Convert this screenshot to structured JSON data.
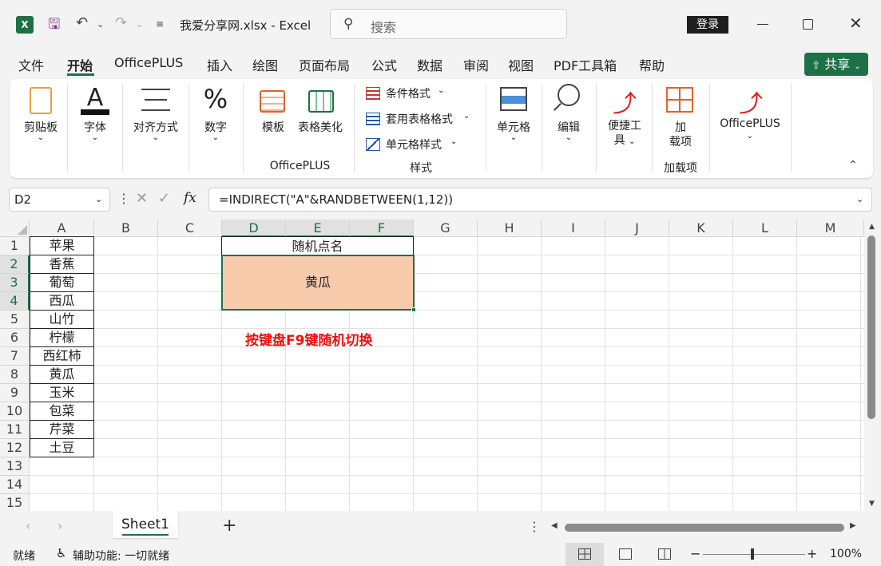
{
  "title_bar": {
    "file_title": "我爱分享网.xlsx  -  Excel",
    "search_placeholder": "搜索",
    "login_label": "登录"
  },
  "menu": {
    "items": [
      "文件",
      "开始",
      "OfficePLUS",
      "插入",
      "绘图",
      "页面布局",
      "公式",
      "数据",
      "审阅",
      "视图",
      "PDF工具箱",
      "帮助"
    ],
    "active": "开始",
    "share_label": "共享"
  },
  "ribbon": {
    "clipboard": "剪贴板",
    "font": "字体",
    "align": "对齐方式",
    "number": "数字",
    "template": "模板",
    "table_beautify": "表格美化",
    "officeplus_group": "OfficePLUS",
    "cond_format": "条件格式",
    "table_format": "套用表格格式",
    "cell_style": "单元格样式",
    "styles_group": "样式",
    "cells": "单元格",
    "edit": "编辑",
    "tools_line1": "便捷工",
    "tools_line2": "具",
    "addin_line1": "加",
    "addin_line2": "载项",
    "addin_group": "加载项",
    "officeplus_btn": "OfficePLUS"
  },
  "formula_bar": {
    "name_box": "D2",
    "fx": "fx",
    "formula": "=INDIRECT(\"A\"&RANDBETWEEN(1,12))"
  },
  "grid": {
    "columns": [
      "A",
      "B",
      "C",
      "D",
      "E",
      "F",
      "G",
      "H",
      "I",
      "J",
      "K",
      "L",
      "M"
    ],
    "rows": [
      "1",
      "2",
      "3",
      "4",
      "5",
      "6",
      "7",
      "8",
      "9",
      "10",
      "11",
      "12",
      "13",
      "14",
      "15"
    ],
    "column_a": [
      "苹果",
      "香蕉",
      "葡萄",
      "西瓜",
      "山竹",
      "柠檬",
      "西红柿",
      "黄瓜",
      "玉米",
      "包菜",
      "芹菜",
      "土豆"
    ],
    "d1_header": "随机点名",
    "d2_result": "黄瓜",
    "note": "按键盘F9键随机切换",
    "result_fill": "#f8cbad",
    "note_color": "#ee1111"
  },
  "sheet_tabs": {
    "active_sheet": "Sheet1",
    "add_label": "+"
  },
  "status_bar": {
    "ready": "就绪",
    "accessibility": "辅助功能: 一切就绪",
    "zoom": "100%"
  },
  "colors": {
    "excel_green": "#1e7145"
  }
}
